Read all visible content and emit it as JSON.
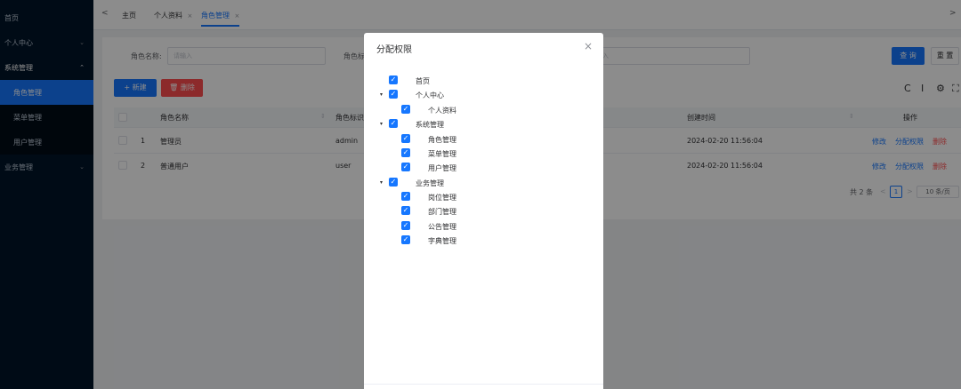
{
  "sidebar": {
    "items": [
      {
        "label": "首页"
      },
      {
        "label": "个人中心",
        "chevron": "⌄"
      },
      {
        "label": "系统管理",
        "chevron": "⌃"
      },
      {
        "label": "角色管理"
      },
      {
        "label": "菜单管理"
      },
      {
        "label": "用户管理"
      },
      {
        "label": "业务管理",
        "chevron": "⌄"
      }
    ]
  },
  "tabs": {
    "left_arrow": "<",
    "right_arrow": ">",
    "items": [
      {
        "label": "主页"
      },
      {
        "label": "个人资料",
        "close": "×"
      },
      {
        "label": "角色管理",
        "close": "×"
      }
    ]
  },
  "search": {
    "role_name_label": "角色名称:",
    "role_name_placeholder": "请输入",
    "role_key_label": "角色标",
    "third_placeholder": "入",
    "query_label": "查 询",
    "reset_label": "重 置"
  },
  "toolbar": {
    "add_label": "+ 新建",
    "delete_label": "🗑 删除",
    "refresh_icon": "C",
    "density_icon": "I",
    "settings_icon": "⚙",
    "fullscreen_icon": "⛶"
  },
  "table": {
    "headers": {
      "name": "角色名称",
      "key": "角色标识",
      "created": "创建时间",
      "ops": "操作",
      "sort_icon": "⇕"
    },
    "rows": [
      {
        "index": "1",
        "name": "管理员",
        "key": "admin",
        "created": "2024-02-20 11:56:04",
        "edit": "修改",
        "assign": "分配权限",
        "delete": "删除"
      },
      {
        "index": "2",
        "name": "普通用户",
        "key": "user",
        "created": "2024-02-20 11:56:04",
        "edit": "修改",
        "assign": "分配权限",
        "delete": "删除"
      }
    ]
  },
  "pagination": {
    "total": "共 2 条",
    "prev": "<",
    "page": "1",
    "next": ">",
    "page_size": "10 条/页"
  },
  "modal": {
    "title": "分配权限",
    "close": "×",
    "tree": [
      {
        "label": "首页",
        "checked": true
      },
      {
        "label": "个人中心",
        "checked": true,
        "caret": "▾"
      },
      {
        "label": "个人资料",
        "checked": true
      },
      {
        "label": "系统管理",
        "checked": true,
        "caret": "▾"
      },
      {
        "label": "角色管理",
        "checked": true
      },
      {
        "label": "菜单管理",
        "checked": true
      },
      {
        "label": "用户管理",
        "checked": true
      },
      {
        "label": "业务管理",
        "checked": true,
        "caret": "▾"
      },
      {
        "label": "岗位管理",
        "checked": true
      },
      {
        "label": "部门管理",
        "checked": true
      },
      {
        "label": "公告管理",
        "checked": true
      },
      {
        "label": "字典管理",
        "checked": true
      }
    ],
    "checkmark": "✓"
  },
  "colors": {
    "primary": "#1677ff",
    "danger": "#ff4d4f",
    "sidebar_bg": "#001529"
  }
}
